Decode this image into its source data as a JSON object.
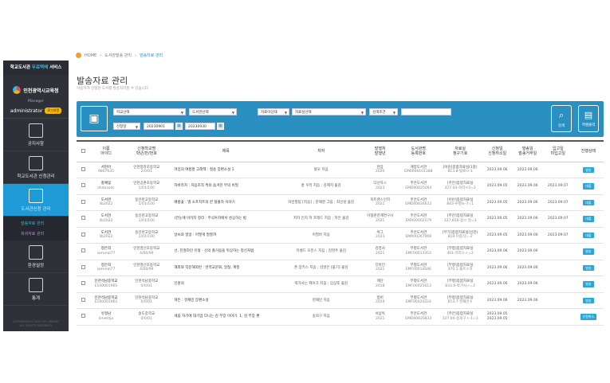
{
  "sidebar": {
    "brand_prefix": "학교도서관 ",
    "brand_accent": "무료택배",
    "brand_suffix": " 서비스",
    "org_name": "인천광역시교육청",
    "role": "Manager",
    "username": "administrator",
    "logout": "로그아웃",
    "menus": [
      {
        "label": "공지사항",
        "icon": "notice-icon"
      },
      {
        "label": "학교도서관 신청관리",
        "icon": "document-icon"
      },
      {
        "label": "도서관신청 관리",
        "icon": "book-icon"
      },
      {
        "label": "환경설정",
        "icon": "settings-sliders-icon"
      },
      {
        "label": "통계",
        "icon": "chart-icon"
      }
    ],
    "sub_items": [
      "발송자료 관리",
      "복귀자료 관리"
    ],
    "footer_line1": "COPYRIGHT(C) 2019 ICE LIBRARY",
    "footer_line2": "ALL RIGHTS RESERVED"
  },
  "breadcrumb": {
    "home": "HOME",
    "level1": "도서관발송 관리",
    "current": "발송자료 관리"
  },
  "page": {
    "title": "발송자료 관리",
    "description": "이용자가 신청한 도서를 발송처리할 수 있습니다."
  },
  "search": {
    "school_select": "학교선택",
    "library_select": "도서관선택",
    "material_status": "자료이상태",
    "material_select": "자료실선택",
    "search_condition": "검색조건",
    "keyword_value": "",
    "date_type": "신청일",
    "date_from": "20230901",
    "date_to": "20230930",
    "search_button": "검색",
    "excel_button": "엑셀출력"
  },
  "table": {
    "headers": [
      "이름\n아이디",
      "신청학교명\n학년/반/번호",
      "제목",
      "저자",
      "발행처\n발행년",
      "도서관명\n등록번호",
      "자료실\n청구기호",
      "신청일\n신청취소일",
      "발송일\n발송거부일",
      "입고일\n미입고일",
      "진행상태"
    ],
    "rows": [
      {
        "name": "서현아",
        "id": "9807635",
        "school": "인천청라초등학교",
        "grade": "2/0/01",
        "title": "려임의 여름풍 고래책 : 칠송 장편소설 1",
        "author": "탈모 지음",
        "publisher": "현암",
        "year": "2020",
        "library": "계양도서관",
        "regno": "EM0000101388",
        "room": "[어린]종합자료실(1층)",
        "call": "813.8-탈로ㅁ-1",
        "req": "2023.09.06",
        "sent": "2023.09.06",
        "in": "",
        "status": "발송"
      },
      {
        "name": "홍예빛",
        "id": "ahdusodc",
        "school": "인천공촌초등학교",
        "grade": "1/01/100",
        "title": "하바라자 : 자음조직 싹의 숨겨진 부의 비밀",
        "author": "홍 우리 지음 ; 김혜지 옮김",
        "publisher": "다산북스",
        "year": "2023",
        "library": "주안도서관",
        "regno": "EMD00025064",
        "room": "[주안]종합자료실",
        "call": "327.04-하라ㄹ3=2",
        "req": "2023.09.05",
        "sent": "2023.09.06",
        "in": "2023.09.07",
        "status": "대출"
      },
      {
        "name": "도서관",
        "id": "lib2022",
        "school": "동인천고등학교",
        "grade": "1/01/100",
        "title": "배롱꽃 : 별 소프치트의 한 탈출자 이야기",
        "author": "차민필팀 [지음] ; 한해영 그림 ; 최인성 옮김",
        "publisher": "북트랜스인지",
        "year": "2021",
        "library": "주안도서관",
        "regno": "EMD00026612",
        "room": "[어린]종합자료실",
        "call": "843-수평ㅂ-7=1",
        "req": "2023.09.05",
        "sent": "2023.09.06",
        "in": "2023.09.07",
        "status": "대출"
      },
      {
        "name": "도서관",
        "id": "lib2022",
        "school": "동인천고등학교",
        "grade": "1/01/100",
        "title": "(한눈에 이미지 정리 : 주식투자에서 성공하는 법",
        "author": "저자 인지 저 프레드 지음 ; 저은 옮김",
        "publisher": "이형준한계연구사",
        "year": "2021",
        "library": "주안도서관",
        "regno": "EMA00002179",
        "room": "[주안]종합자료실",
        "call": "327.856-링ㅁ 일=3",
        "req": "2023.09.05",
        "sent": "2023.09.06",
        "in": "2023.09.07",
        "status": "대출"
      },
      {
        "name": "도서관",
        "id": "lib2022",
        "school": "동인천고등학교",
        "grade": "1/01/100",
        "title": "날씨와 얼굴 : 어떻게 말할까",
        "author": "이필바 지음",
        "publisher": "위그",
        "year": "2023",
        "library": "주안도서관",
        "regno": "EMA00267969",
        "room": "[부가]종합자료실(신관)",
        "call": "818-이중식ㄴ-2",
        "req": "2023.09.05",
        "sent": "2023.09.06",
        "in": "2023.09.07",
        "status": "대출"
      },
      {
        "name": "정은희",
        "id": "iamreal77",
        "school": "인천영선초등학교",
        "grade": "4/06/99",
        "title": "선, 친절하던 유형 · 신의 즐거움을 뒤상하는 정신처럼",
        "author": "미셀드 오진스 지음 ; 김영주 옮김",
        "publisher": "김영사",
        "year": "2021",
        "library": "부평도서관",
        "regno": "EMF00013353",
        "room": "[부평]종합자료실",
        "call": "401-프라스ㅅ=2",
        "req": "2023.09.06",
        "sent": "2023.09.06",
        "in": "",
        "status": "발송"
      },
      {
        "name": "정은희",
        "id": "iamreal77",
        "school": "인천영선초등학교",
        "grade": "4/06/99",
        "title": "해외와 작문해외번 : 번역교문화, 일정, 계정",
        "author": "존 장키스 지음 ; 김영은 [옮기] 옮김",
        "publisher": "더마인",
        "year": "2021",
        "library": "부평도서관",
        "regno": "EMF00014046",
        "room": "[부평]종합자료실",
        "call": "370.1-풀트스하",
        "req": "2023.09.06",
        "sent": "2023.09.06",
        "in": "",
        "status": "발송"
      },
      {
        "name": "인천석남중학교",
        "id": "E100001965",
        "school": "인천석남중학교",
        "grade": "0/0/01",
        "title": "신원의",
        "author": "박가사는 제이크 지음 ; 임상후 옮김",
        "publisher": "계단",
        "year": "2018",
        "library": "부평도서관",
        "regno": "EMF00025613",
        "room": "[부평]종합자료실",
        "call": "833.6-박가사ㅅ=2",
        "req": "2023.09.06",
        "sent": "2023.09.06",
        "in": "",
        "status": "발송"
      },
      {
        "name": "인천석남중학교",
        "id": "E100001965",
        "school": "인천석남중학교",
        "grade": "0/0/01",
        "title": "혀든 : 현재민 장편소설",
        "author": "현재민 지음",
        "publisher": "창비",
        "year": "2019",
        "library": "부평도서관",
        "regno": "EMF00024224",
        "room": "[부평]종합자료실",
        "call": "813.7-현재민ㅎ",
        "req": "2023.09.06",
        "sent": "2023.09.06",
        "in": "",
        "status": "발송"
      },
      {
        "name": "유형남",
        "id": "limetaja",
        "school": "송도중학교",
        "grade": "0/0/01",
        "title": "세움 자기에 대기업 다니는 김 부장 이야기. 1, 김 부장 편",
        "author": "송희구 지음",
        "publisher": "서삼독",
        "year": "2021",
        "library": "주안도서관",
        "regno": "EMD00020833",
        "room": "[주안]종합자료실",
        "call": "327.04-송희구ㅅ-1=3",
        "req": "2023.09.05\n2023.09.05",
        "sent": "",
        "in": "",
        "status": "신청취소"
      }
    ]
  },
  "colors": {
    "accent": "#1e9bd7",
    "searchbar": "#2a8fc1",
    "sidebar": "#2f3139"
  }
}
